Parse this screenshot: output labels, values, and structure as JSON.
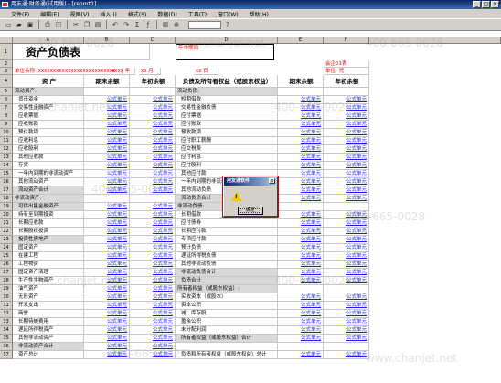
{
  "window": {
    "title": "用友通·财务通(试用版) - [report1]"
  },
  "menu": [
    "文件(F)",
    "编辑(E)",
    "视图(V)",
    "插入(I)",
    "格式(S)",
    "数据(D)",
    "工具(T)",
    "窗口(W)",
    "帮助(H)"
  ],
  "columns": [
    "A",
    "B",
    "C",
    "D",
    "E",
    "F"
  ],
  "sheet": {
    "title": "资产负债表",
    "date_label": "年中期间",
    "unit_label": "单位名称: xxxxxxxxxxxxxxxxxxxxxxxxxx",
    "period_label": "xxxx 年",
    "month_label": "xx 月",
    "day_label": "xx 日",
    "form_code": "会企01表",
    "currency": "单位: 元",
    "headers": [
      "资      产",
      "期末余额",
      "年初余额",
      "负债及所有者权益（或股东权益）",
      "期末余额",
      "年初余额"
    ],
    "formula_text": "公式单元"
  },
  "rows": [
    {
      "n": "5",
      "a": "流动资产:",
      "d": "流动负债:",
      "f": false,
      "gf": false
    },
    {
      "n": "6",
      "a": "货币资金",
      "d": "短期借款",
      "f": true,
      "gf": true
    },
    {
      "n": "7",
      "a": "交易性金融资产",
      "d": "交易性金融负债",
      "f": true,
      "gf": true
    },
    {
      "n": "8",
      "a": "应收票据",
      "d": "应付票据",
      "f": true,
      "gf": true
    },
    {
      "n": "9",
      "a": "应收账款",
      "d": "应付账款",
      "f": true,
      "gf": true
    },
    {
      "n": "10",
      "a": "预付款项",
      "d": "预收款项",
      "f": true,
      "gf": true
    },
    {
      "n": "11",
      "a": "应收利息",
      "d": "应付职工薪酬",
      "f": true,
      "gf": true
    },
    {
      "n": "12",
      "a": "应收股利",
      "d": "应交税费",
      "f": true,
      "gf": true
    },
    {
      "n": "13",
      "a": "其他应收款",
      "d": "应付利息",
      "f": true,
      "gf": true
    },
    {
      "n": "14",
      "a": "存货",
      "d": "应付股利",
      "f": true,
      "gf": true
    },
    {
      "n": "15",
      "a": "一年内到期的非流动资产",
      "d": "其他应付款",
      "f": true,
      "gf": true
    },
    {
      "n": "16",
      "a": "其他流动资产",
      "d": "一年内到期的非流动负债",
      "f": true,
      "gf": true
    },
    {
      "n": "17",
      "a": "流动资产合计",
      "d": "其他流动负债",
      "f": true,
      "gf": true
    },
    {
      "n": "18",
      "a": "非流动资产:",
      "d": "流动负债合计",
      "f": false,
      "gf": true
    },
    {
      "n": "19",
      "a": "可供出售金融资产",
      "d": "非流动负债:",
      "f": true,
      "gf": false
    },
    {
      "n": "20",
      "a": "持有至到期投资",
      "d": "长期借款",
      "f": true,
      "gf": true
    },
    {
      "n": "21",
      "a": "长期应收款",
      "d": "应付债券",
      "f": true,
      "gf": true
    },
    {
      "n": "22",
      "a": "长期股权投资",
      "d": "长期应付款",
      "f": true,
      "gf": true
    },
    {
      "n": "23",
      "a": "投资性房地产",
      "d": "专项应付款",
      "f": true,
      "gf": true
    },
    {
      "n": "24",
      "a": "固定资产",
      "d": "预计负债",
      "f": true,
      "gf": true
    },
    {
      "n": "25",
      "a": "在建工程",
      "d": "递延所得税负债",
      "f": true,
      "gf": true
    },
    {
      "n": "26",
      "a": "工程物资",
      "d": "其他非流动负债",
      "f": true,
      "gf": true
    },
    {
      "n": "27",
      "a": "固定资产清理",
      "d": "非流动负债合计",
      "f": true,
      "gf": true
    },
    {
      "n": "28",
      "a": "生产性生物资产",
      "d": "负债合计",
      "f": true,
      "gf": true
    },
    {
      "n": "29",
      "a": "油气资产",
      "d": "所有者权益（或股东权益）:",
      "f": true,
      "gf": false
    },
    {
      "n": "30",
      "a": "无形资产",
      "d": "实收资本（或股本）",
      "f": true,
      "gf": true
    },
    {
      "n": "31",
      "a": "开发支出",
      "d": "资本公积",
      "f": true,
      "gf": true
    },
    {
      "n": "32",
      "a": "商誉",
      "d": "减：库存股",
      "f": true,
      "gf": true
    },
    {
      "n": "33",
      "a": "长期待摊费用",
      "d": "盈余公积",
      "f": true,
      "gf": true
    },
    {
      "n": "34",
      "a": "递延所得税资产",
      "d": "未分配利润",
      "f": true,
      "gf": true
    },
    {
      "n": "35",
      "a": "其他非流动资产",
      "d": "所有者权益（或股东权益）合计",
      "f": true,
      "gf": true
    },
    {
      "n": "36",
      "a": "非流动资产合计",
      "d": "",
      "f": true,
      "gf": false
    },
    {
      "n": "37",
      "a": "资产总计",
      "d": "负债和所有者权益（或股东权益）总计",
      "f": true,
      "gf": true
    }
  ],
  "dialog": {
    "title": "用友通软件",
    "ok": "确定"
  },
  "watermark": {
    "phone": "400-665-0028",
    "site": "www.chanjet.net"
  }
}
